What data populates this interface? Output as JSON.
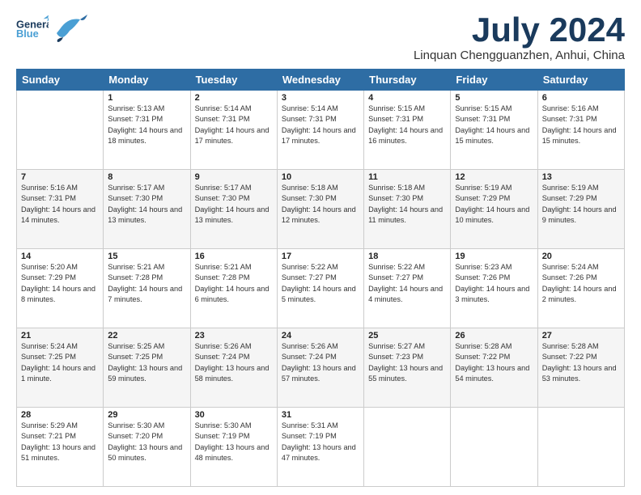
{
  "header": {
    "logo_line1": "General",
    "logo_line2": "Blue",
    "month": "July 2024",
    "location": "Linquan Chengguanzhen, Anhui, China"
  },
  "weekdays": [
    "Sunday",
    "Monday",
    "Tuesday",
    "Wednesday",
    "Thursday",
    "Friday",
    "Saturday"
  ],
  "weeks": [
    [
      {
        "day": "",
        "sunrise": "",
        "sunset": "",
        "daylight": ""
      },
      {
        "day": "1",
        "sunrise": "Sunrise: 5:13 AM",
        "sunset": "Sunset: 7:31 PM",
        "daylight": "Daylight: 14 hours and 18 minutes."
      },
      {
        "day": "2",
        "sunrise": "Sunrise: 5:14 AM",
        "sunset": "Sunset: 7:31 PM",
        "daylight": "Daylight: 14 hours and 17 minutes."
      },
      {
        "day": "3",
        "sunrise": "Sunrise: 5:14 AM",
        "sunset": "Sunset: 7:31 PM",
        "daylight": "Daylight: 14 hours and 17 minutes."
      },
      {
        "day": "4",
        "sunrise": "Sunrise: 5:15 AM",
        "sunset": "Sunset: 7:31 PM",
        "daylight": "Daylight: 14 hours and 16 minutes."
      },
      {
        "day": "5",
        "sunrise": "Sunrise: 5:15 AM",
        "sunset": "Sunset: 7:31 PM",
        "daylight": "Daylight: 14 hours and 15 minutes."
      },
      {
        "day": "6",
        "sunrise": "Sunrise: 5:16 AM",
        "sunset": "Sunset: 7:31 PM",
        "daylight": "Daylight: 14 hours and 15 minutes."
      }
    ],
    [
      {
        "day": "7",
        "sunrise": "Sunrise: 5:16 AM",
        "sunset": "Sunset: 7:31 PM",
        "daylight": "Daylight: 14 hours and 14 minutes."
      },
      {
        "day": "8",
        "sunrise": "Sunrise: 5:17 AM",
        "sunset": "Sunset: 7:30 PM",
        "daylight": "Daylight: 14 hours and 13 minutes."
      },
      {
        "day": "9",
        "sunrise": "Sunrise: 5:17 AM",
        "sunset": "Sunset: 7:30 PM",
        "daylight": "Daylight: 14 hours and 13 minutes."
      },
      {
        "day": "10",
        "sunrise": "Sunrise: 5:18 AM",
        "sunset": "Sunset: 7:30 PM",
        "daylight": "Daylight: 14 hours and 12 minutes."
      },
      {
        "day": "11",
        "sunrise": "Sunrise: 5:18 AM",
        "sunset": "Sunset: 7:30 PM",
        "daylight": "Daylight: 14 hours and 11 minutes."
      },
      {
        "day": "12",
        "sunrise": "Sunrise: 5:19 AM",
        "sunset": "Sunset: 7:29 PM",
        "daylight": "Daylight: 14 hours and 10 minutes."
      },
      {
        "day": "13",
        "sunrise": "Sunrise: 5:19 AM",
        "sunset": "Sunset: 7:29 PM",
        "daylight": "Daylight: 14 hours and 9 minutes."
      }
    ],
    [
      {
        "day": "14",
        "sunrise": "Sunrise: 5:20 AM",
        "sunset": "Sunset: 7:29 PM",
        "daylight": "Daylight: 14 hours and 8 minutes."
      },
      {
        "day": "15",
        "sunrise": "Sunrise: 5:21 AM",
        "sunset": "Sunset: 7:28 PM",
        "daylight": "Daylight: 14 hours and 7 minutes."
      },
      {
        "day": "16",
        "sunrise": "Sunrise: 5:21 AM",
        "sunset": "Sunset: 7:28 PM",
        "daylight": "Daylight: 14 hours and 6 minutes."
      },
      {
        "day": "17",
        "sunrise": "Sunrise: 5:22 AM",
        "sunset": "Sunset: 7:27 PM",
        "daylight": "Daylight: 14 hours and 5 minutes."
      },
      {
        "day": "18",
        "sunrise": "Sunrise: 5:22 AM",
        "sunset": "Sunset: 7:27 PM",
        "daylight": "Daylight: 14 hours and 4 minutes."
      },
      {
        "day": "19",
        "sunrise": "Sunrise: 5:23 AM",
        "sunset": "Sunset: 7:26 PM",
        "daylight": "Daylight: 14 hours and 3 minutes."
      },
      {
        "day": "20",
        "sunrise": "Sunrise: 5:24 AM",
        "sunset": "Sunset: 7:26 PM",
        "daylight": "Daylight: 14 hours and 2 minutes."
      }
    ],
    [
      {
        "day": "21",
        "sunrise": "Sunrise: 5:24 AM",
        "sunset": "Sunset: 7:25 PM",
        "daylight": "Daylight: 14 hours and 1 minute."
      },
      {
        "day": "22",
        "sunrise": "Sunrise: 5:25 AM",
        "sunset": "Sunset: 7:25 PM",
        "daylight": "Daylight: 13 hours and 59 minutes."
      },
      {
        "day": "23",
        "sunrise": "Sunrise: 5:26 AM",
        "sunset": "Sunset: 7:24 PM",
        "daylight": "Daylight: 13 hours and 58 minutes."
      },
      {
        "day": "24",
        "sunrise": "Sunrise: 5:26 AM",
        "sunset": "Sunset: 7:24 PM",
        "daylight": "Daylight: 13 hours and 57 minutes."
      },
      {
        "day": "25",
        "sunrise": "Sunrise: 5:27 AM",
        "sunset": "Sunset: 7:23 PM",
        "daylight": "Daylight: 13 hours and 55 minutes."
      },
      {
        "day": "26",
        "sunrise": "Sunrise: 5:28 AM",
        "sunset": "Sunset: 7:22 PM",
        "daylight": "Daylight: 13 hours and 54 minutes."
      },
      {
        "day": "27",
        "sunrise": "Sunrise: 5:28 AM",
        "sunset": "Sunset: 7:22 PM",
        "daylight": "Daylight: 13 hours and 53 minutes."
      }
    ],
    [
      {
        "day": "28",
        "sunrise": "Sunrise: 5:29 AM",
        "sunset": "Sunset: 7:21 PM",
        "daylight": "Daylight: 13 hours and 51 minutes."
      },
      {
        "day": "29",
        "sunrise": "Sunrise: 5:30 AM",
        "sunset": "Sunset: 7:20 PM",
        "daylight": "Daylight: 13 hours and 50 minutes."
      },
      {
        "day": "30",
        "sunrise": "Sunrise: 5:30 AM",
        "sunset": "Sunset: 7:19 PM",
        "daylight": "Daylight: 13 hours and 48 minutes."
      },
      {
        "day": "31",
        "sunrise": "Sunrise: 5:31 AM",
        "sunset": "Sunset: 7:19 PM",
        "daylight": "Daylight: 13 hours and 47 minutes."
      },
      {
        "day": "",
        "sunrise": "",
        "sunset": "",
        "daylight": ""
      },
      {
        "day": "",
        "sunrise": "",
        "sunset": "",
        "daylight": ""
      },
      {
        "day": "",
        "sunrise": "",
        "sunset": "",
        "daylight": ""
      }
    ]
  ]
}
